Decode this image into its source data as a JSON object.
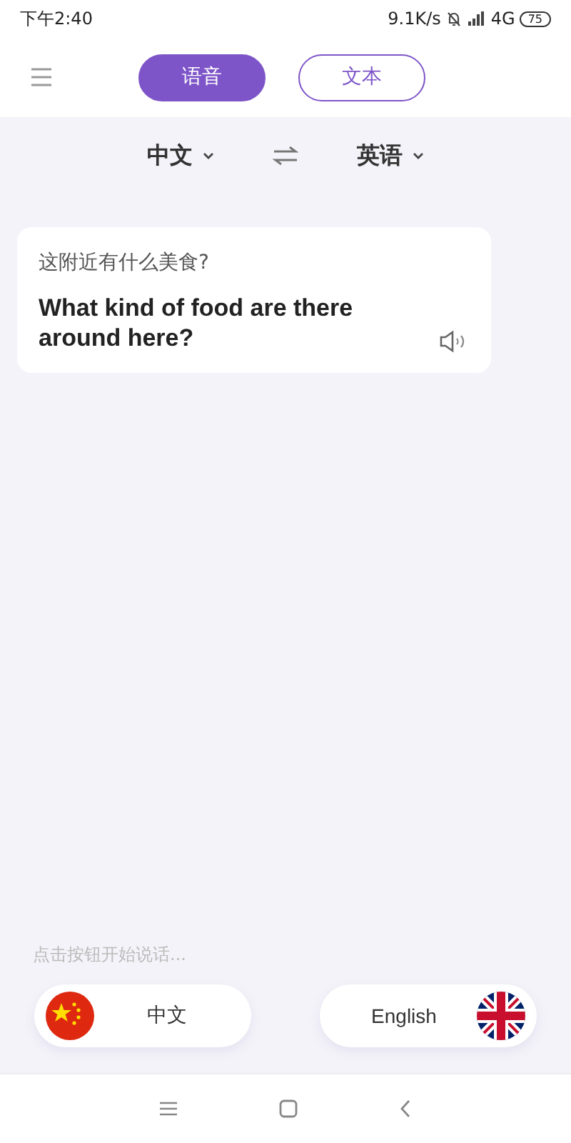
{
  "status_bar": {
    "time": "下午2:40",
    "network_speed": "9.1K/s",
    "network": "4G",
    "battery": "75"
  },
  "tabs": [
    {
      "label": "语音",
      "selected": true
    },
    {
      "label": "文本",
      "selected": false
    }
  ],
  "language_bar": {
    "source": "中文",
    "target": "英语"
  },
  "translation_card": {
    "source_text": "这附近有什么美食?",
    "translated_text": "What kind of food are there around here?"
  },
  "prompt": "点击按钮开始说话...",
  "speak_buttons": [
    {
      "label": "中文",
      "kind": "china"
    },
    {
      "label": "English",
      "kind": "uk"
    }
  ]
}
